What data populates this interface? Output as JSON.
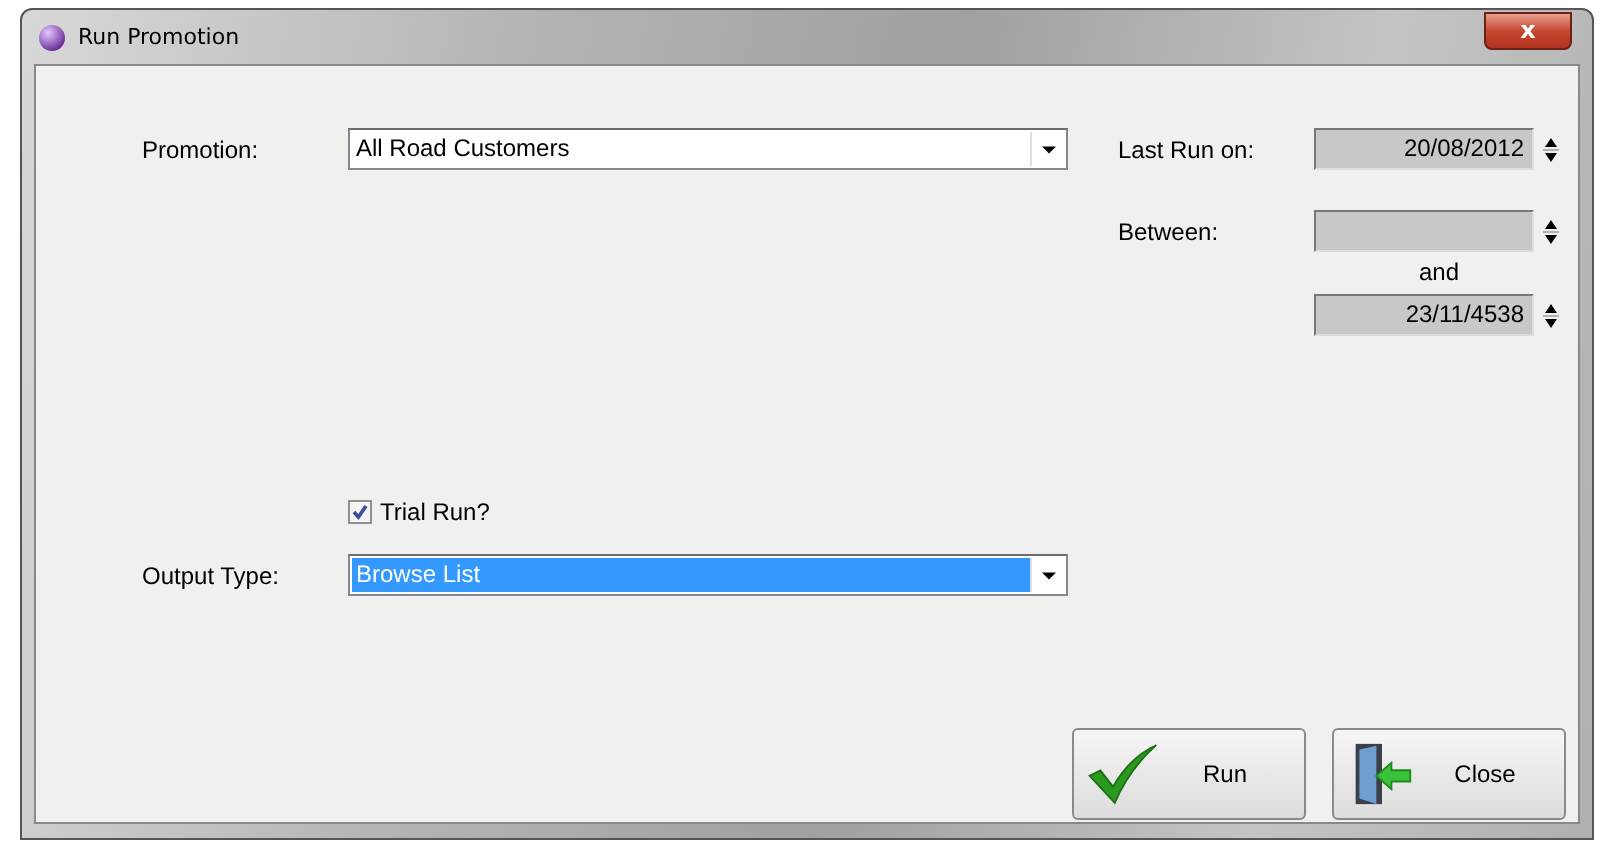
{
  "window": {
    "title": "Run Promotion",
    "close_label": "x"
  },
  "promotion": {
    "label": "Promotion:",
    "value": "All Road Customers"
  },
  "last_run": {
    "label": "Last Run on:",
    "value": "20/08/2012"
  },
  "between": {
    "label": "Between:",
    "joiner": "and",
    "to": "23/11/4538"
  },
  "trial_run": {
    "label": "Trial Run?",
    "checked": true
  },
  "output_type": {
    "label": "Output Type:",
    "value": "Browse List",
    "selected": true
  },
  "buttons": [
    {
      "label": "Run",
      "kind": "check"
    },
    {
      "label": "Close",
      "kind": "door"
    }
  ]
}
